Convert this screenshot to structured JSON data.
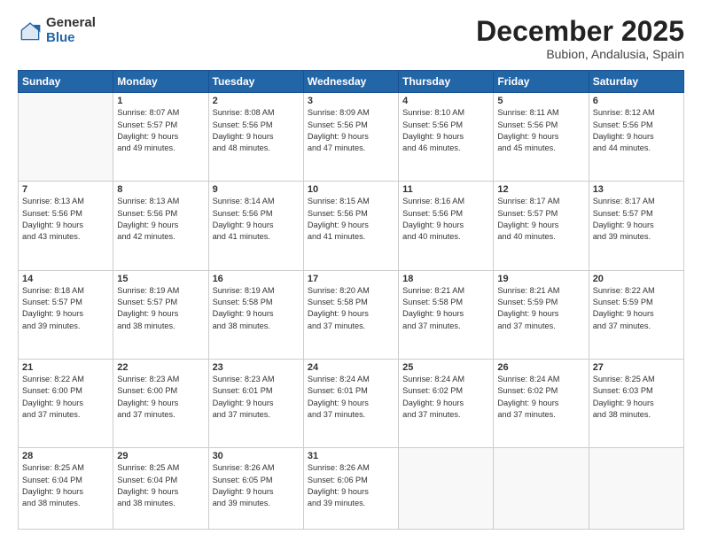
{
  "header": {
    "logo_general": "General",
    "logo_blue": "Blue",
    "month": "December 2025",
    "location": "Bubion, Andalusia, Spain"
  },
  "days_of_week": [
    "Sunday",
    "Monday",
    "Tuesday",
    "Wednesday",
    "Thursday",
    "Friday",
    "Saturday"
  ],
  "weeks": [
    [
      {
        "day": "",
        "info": ""
      },
      {
        "day": "1",
        "info": "Sunrise: 8:07 AM\nSunset: 5:57 PM\nDaylight: 9 hours\nand 49 minutes."
      },
      {
        "day": "2",
        "info": "Sunrise: 8:08 AM\nSunset: 5:56 PM\nDaylight: 9 hours\nand 48 minutes."
      },
      {
        "day": "3",
        "info": "Sunrise: 8:09 AM\nSunset: 5:56 PM\nDaylight: 9 hours\nand 47 minutes."
      },
      {
        "day": "4",
        "info": "Sunrise: 8:10 AM\nSunset: 5:56 PM\nDaylight: 9 hours\nand 46 minutes."
      },
      {
        "day": "5",
        "info": "Sunrise: 8:11 AM\nSunset: 5:56 PM\nDaylight: 9 hours\nand 45 minutes."
      },
      {
        "day": "6",
        "info": "Sunrise: 8:12 AM\nSunset: 5:56 PM\nDaylight: 9 hours\nand 44 minutes."
      }
    ],
    [
      {
        "day": "7",
        "info": "Sunrise: 8:13 AM\nSunset: 5:56 PM\nDaylight: 9 hours\nand 43 minutes."
      },
      {
        "day": "8",
        "info": "Sunrise: 8:13 AM\nSunset: 5:56 PM\nDaylight: 9 hours\nand 42 minutes."
      },
      {
        "day": "9",
        "info": "Sunrise: 8:14 AM\nSunset: 5:56 PM\nDaylight: 9 hours\nand 41 minutes."
      },
      {
        "day": "10",
        "info": "Sunrise: 8:15 AM\nSunset: 5:56 PM\nDaylight: 9 hours\nand 41 minutes."
      },
      {
        "day": "11",
        "info": "Sunrise: 8:16 AM\nSunset: 5:56 PM\nDaylight: 9 hours\nand 40 minutes."
      },
      {
        "day": "12",
        "info": "Sunrise: 8:17 AM\nSunset: 5:57 PM\nDaylight: 9 hours\nand 40 minutes."
      },
      {
        "day": "13",
        "info": "Sunrise: 8:17 AM\nSunset: 5:57 PM\nDaylight: 9 hours\nand 39 minutes."
      }
    ],
    [
      {
        "day": "14",
        "info": "Sunrise: 8:18 AM\nSunset: 5:57 PM\nDaylight: 9 hours\nand 39 minutes."
      },
      {
        "day": "15",
        "info": "Sunrise: 8:19 AM\nSunset: 5:57 PM\nDaylight: 9 hours\nand 38 minutes."
      },
      {
        "day": "16",
        "info": "Sunrise: 8:19 AM\nSunset: 5:58 PM\nDaylight: 9 hours\nand 38 minutes."
      },
      {
        "day": "17",
        "info": "Sunrise: 8:20 AM\nSunset: 5:58 PM\nDaylight: 9 hours\nand 37 minutes."
      },
      {
        "day": "18",
        "info": "Sunrise: 8:21 AM\nSunset: 5:58 PM\nDaylight: 9 hours\nand 37 minutes."
      },
      {
        "day": "19",
        "info": "Sunrise: 8:21 AM\nSunset: 5:59 PM\nDaylight: 9 hours\nand 37 minutes."
      },
      {
        "day": "20",
        "info": "Sunrise: 8:22 AM\nSunset: 5:59 PM\nDaylight: 9 hours\nand 37 minutes."
      }
    ],
    [
      {
        "day": "21",
        "info": "Sunrise: 8:22 AM\nSunset: 6:00 PM\nDaylight: 9 hours\nand 37 minutes."
      },
      {
        "day": "22",
        "info": "Sunrise: 8:23 AM\nSunset: 6:00 PM\nDaylight: 9 hours\nand 37 minutes."
      },
      {
        "day": "23",
        "info": "Sunrise: 8:23 AM\nSunset: 6:01 PM\nDaylight: 9 hours\nand 37 minutes."
      },
      {
        "day": "24",
        "info": "Sunrise: 8:24 AM\nSunset: 6:01 PM\nDaylight: 9 hours\nand 37 minutes."
      },
      {
        "day": "25",
        "info": "Sunrise: 8:24 AM\nSunset: 6:02 PM\nDaylight: 9 hours\nand 37 minutes."
      },
      {
        "day": "26",
        "info": "Sunrise: 8:24 AM\nSunset: 6:02 PM\nDaylight: 9 hours\nand 37 minutes."
      },
      {
        "day": "27",
        "info": "Sunrise: 8:25 AM\nSunset: 6:03 PM\nDaylight: 9 hours\nand 38 minutes."
      }
    ],
    [
      {
        "day": "28",
        "info": "Sunrise: 8:25 AM\nSunset: 6:04 PM\nDaylight: 9 hours\nand 38 minutes."
      },
      {
        "day": "29",
        "info": "Sunrise: 8:25 AM\nSunset: 6:04 PM\nDaylight: 9 hours\nand 38 minutes."
      },
      {
        "day": "30",
        "info": "Sunrise: 8:26 AM\nSunset: 6:05 PM\nDaylight: 9 hours\nand 39 minutes."
      },
      {
        "day": "31",
        "info": "Sunrise: 8:26 AM\nSunset: 6:06 PM\nDaylight: 9 hours\nand 39 minutes."
      },
      {
        "day": "",
        "info": ""
      },
      {
        "day": "",
        "info": ""
      },
      {
        "day": "",
        "info": ""
      }
    ]
  ]
}
